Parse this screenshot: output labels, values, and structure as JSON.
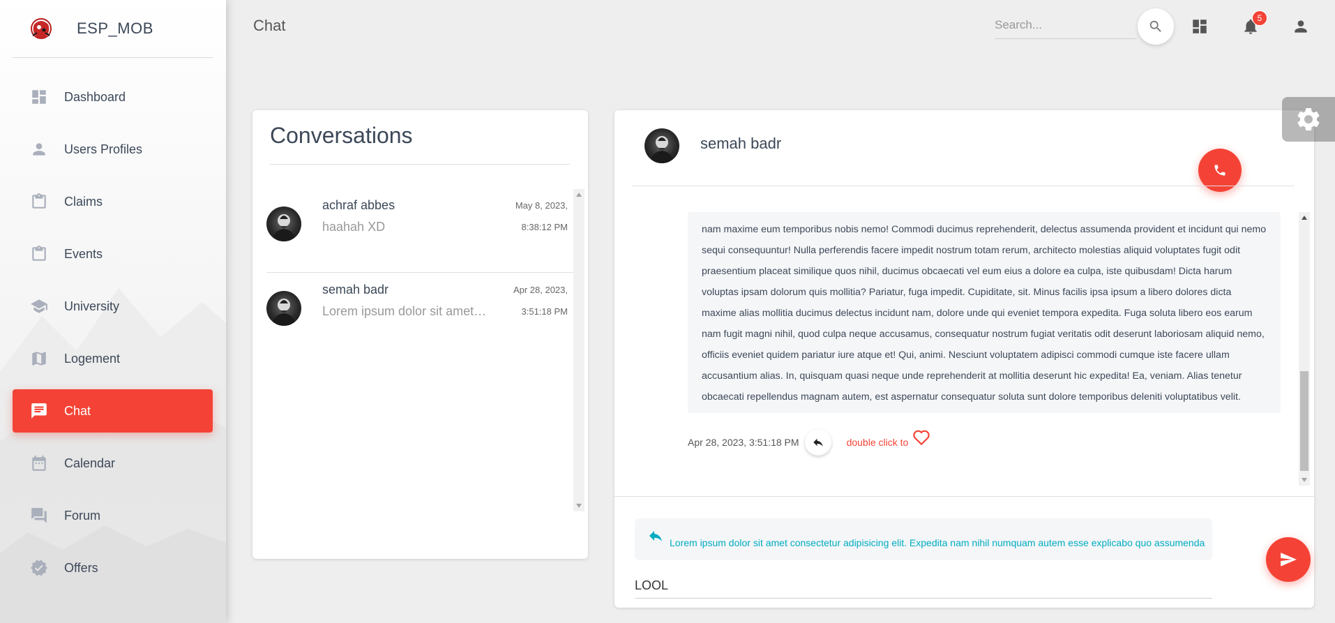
{
  "brand": {
    "name": "ESP_MOB"
  },
  "sidebar": {
    "items": [
      {
        "label": "Dashboard",
        "icon": "dashboard-icon"
      },
      {
        "label": "Users Profiles",
        "icon": "person-icon"
      },
      {
        "label": "Claims",
        "icon": "clipboard-icon"
      },
      {
        "label": "Events",
        "icon": "clipboard-icon"
      },
      {
        "label": "University",
        "icon": "school-icon"
      },
      {
        "label": "Logement",
        "icon": "map-icon"
      },
      {
        "label": "Chat",
        "icon": "chat-icon",
        "active": true
      },
      {
        "label": "Calendar",
        "icon": "calendar-icon"
      },
      {
        "label": "Forum",
        "icon": "forum-icon"
      },
      {
        "label": "Offers",
        "icon": "verified-icon"
      }
    ]
  },
  "header": {
    "title": "Chat",
    "search_placeholder": "Search...",
    "notification_count": "5"
  },
  "conversations": {
    "title": "Conversations",
    "items": [
      {
        "name": "achraf abbes",
        "preview": "haahah XD",
        "date": "May 8, 2023,",
        "time": "8:38:12 PM"
      },
      {
        "name": "semah badr",
        "preview": "Lorem ipsum dolor sit amet consectetur adipisicing elit.",
        "date": "Apr 28, 2023,",
        "time": "3:51:18 PM"
      }
    ]
  },
  "chat": {
    "contact_name": "semah badr",
    "message": {
      "text": "nam maxime eum temporibus nobis nemo! Commodi ducimus reprehenderit, delectus assumenda provident et incidunt qui nemo sequi consequuntur! Nulla perferendis facere impedit nostrum totam rerum, architecto molestias aliquid voluptates fugit odit praesentium placeat similique quos nihil, ducimus obcaecati vel eum eius a dolore ea culpa, iste quibusdam! Dicta harum voluptas ipsam dolorum quis mollitia? Pariatur, fuga impedit. Cupiditate, sit. Minus facilis ipsa ipsum a libero dolores dicta maxime alias mollitia ducimus delectus incidunt nam, dolore unde qui eveniet tempora expedita. Fuga soluta libero eos earum nam fugit magni nihil, quod culpa neque accusamus, consequatur nostrum fugiat veritatis odit deserunt laboriosam aliquid nemo, officiis eveniet quidem pariatur iure atque et! Qui, animi. Nesciunt voluptatem adipisci commodi cumque iste facere ullam accusantium alias. In, quisquam quasi neque unde reprehenderit at mollitia deserunt hic expedita! Ea, veniam. Alias tenetur obcaecati repellendus magnam autem, est aspernatur consequatur soluta sunt dolore temporibus deleniti voluptatibus velit.",
      "timestamp": "Apr 28, 2023, 3:51:18 PM",
      "like_hint": "double click to"
    },
    "reply_preview": "Lorem ipsum dolor sit amet consectetur adipisicing elit. Expedita nam nihil numquam autem esse explicabo quo assumenda",
    "input_value": "LOOL"
  },
  "colors": {
    "accent": "#f44336",
    "reply": "#00acc1",
    "text": "#3c4858",
    "icon_gray": "#a9afbb"
  }
}
